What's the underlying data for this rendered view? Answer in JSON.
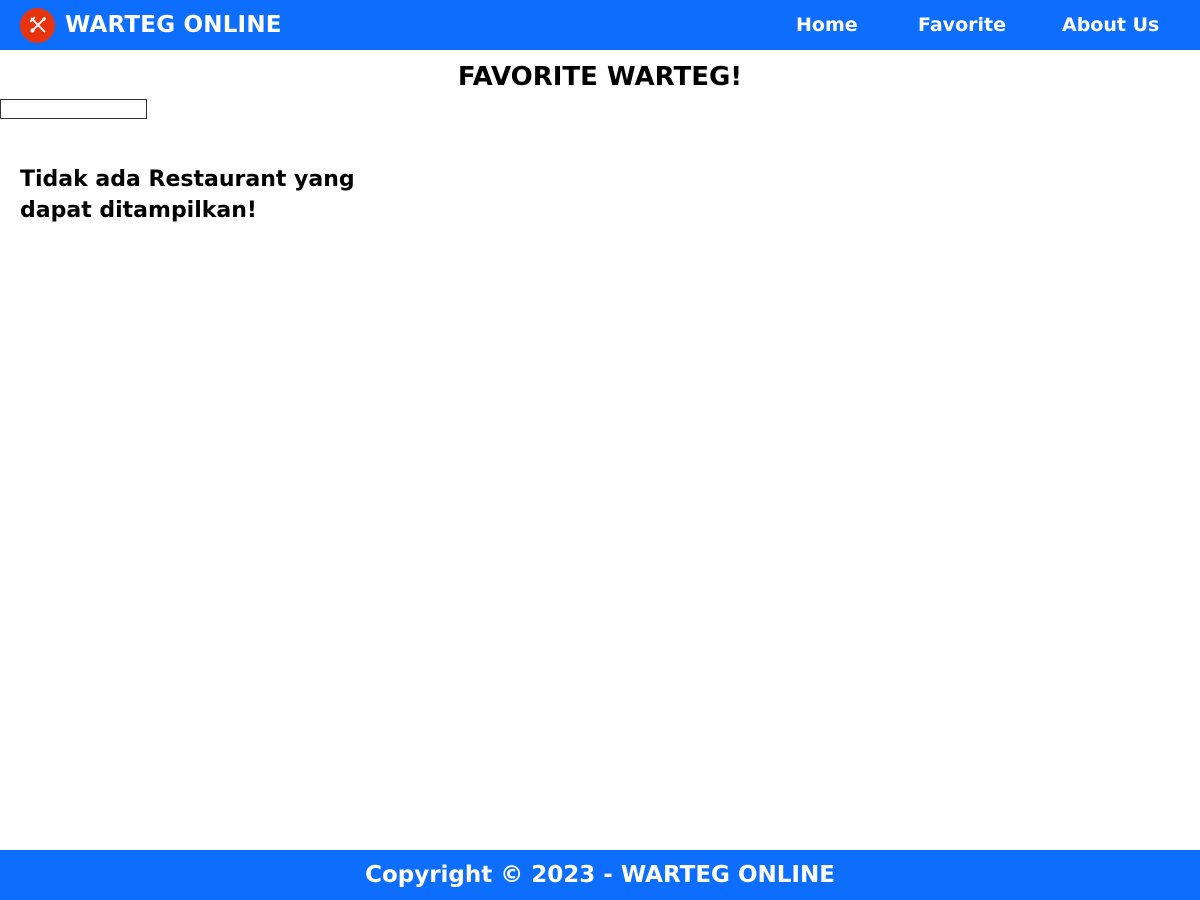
{
  "navbar": {
    "brand": "WARTEG ONLINE",
    "logo_icon": "fork-and-spoon-icon",
    "logo_color": "#e8340e",
    "bg_color": "#0d6efd",
    "links": [
      {
        "label": "Home"
      },
      {
        "label": "Favorite"
      },
      {
        "label": "About Us"
      }
    ]
  },
  "main": {
    "title": "FAVORITE WARTEG!",
    "search": {
      "value": "",
      "placeholder": ""
    },
    "empty_message": "Tidak ada Restaurant yang dapat ditampilkan!"
  },
  "footer": {
    "text": "Copyright © 2023 - WARTEG ONLINE",
    "bg_color": "#0d6efd"
  }
}
